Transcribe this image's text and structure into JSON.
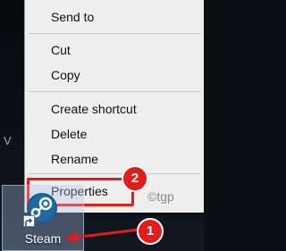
{
  "desktop": {
    "partial_left_glyph": "V"
  },
  "context_menu": {
    "items": [
      {
        "label": "Send to"
      },
      {
        "label": "Cut"
      },
      {
        "label": "Copy"
      },
      {
        "label": "Create shortcut"
      },
      {
        "label": "Delete"
      },
      {
        "label": "Rename"
      },
      {
        "label": "Properties"
      }
    ]
  },
  "annotations": {
    "step1": "1",
    "step2": "2",
    "watermark": "©tgp",
    "accent_color": "#e21b1b"
  },
  "desktop_icon": {
    "label": "Steam",
    "icon": "steam-logo-icon"
  }
}
